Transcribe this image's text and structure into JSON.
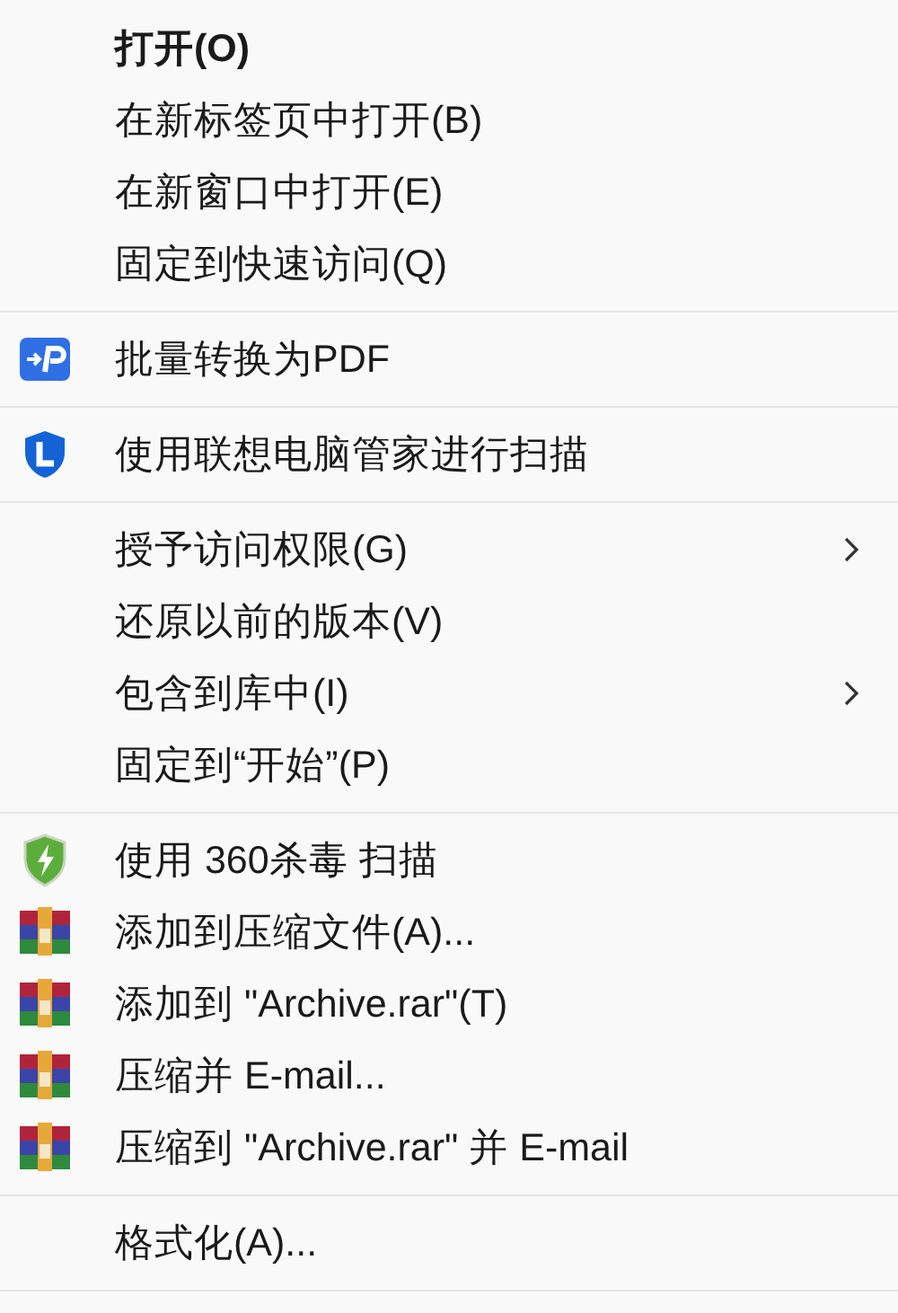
{
  "menu": {
    "groups": [
      {
        "items": [
          {
            "label": "打开(O)",
            "default": true,
            "submenu": false
          },
          {
            "label": "在新标签页中打开(B)",
            "default": false,
            "submenu": false
          },
          {
            "label": "在新窗口中打开(E)",
            "default": false,
            "submenu": false
          },
          {
            "label": "固定到快速访问(Q)",
            "default": false,
            "submenu": false
          }
        ]
      },
      {
        "items": [
          {
            "label": "批量转换为PDF",
            "kind": "pdf",
            "default": false,
            "submenu": false
          }
        ]
      },
      {
        "items": [
          {
            "label": "使用联想电脑管家进行扫描",
            "kind": "lenovo",
            "default": false,
            "submenu": false
          }
        ]
      },
      {
        "items": [
          {
            "label": "授予访问权限(G)",
            "default": false,
            "submenu": true
          },
          {
            "label": "还原以前的版本(V)",
            "default": false,
            "submenu": false
          },
          {
            "label": "包含到库中(I)",
            "default": false,
            "submenu": true
          },
          {
            "label": "固定到“开始”(P)",
            "default": false,
            "submenu": false
          }
        ]
      },
      {
        "items": [
          {
            "label": "使用 360杀毒 扫描",
            "kind": "shield",
            "default": false,
            "submenu": false
          },
          {
            "label": "添加到压缩文件(A)...",
            "kind": "archive",
            "default": false,
            "submenu": false
          },
          {
            "label": "添加到 \"Archive.rar\"(T)",
            "kind": "archive",
            "default": false,
            "submenu": false
          },
          {
            "label": "压缩并 E-mail...",
            "kind": "archive",
            "default": false,
            "submenu": false
          },
          {
            "label": "压缩到 \"Archive.rar\" 并 E-mail",
            "kind": "archive",
            "default": false,
            "submenu": false
          }
        ]
      },
      {
        "items": [
          {
            "label": "格式化(A)...",
            "default": false,
            "submenu": false
          }
        ]
      }
    ]
  }
}
